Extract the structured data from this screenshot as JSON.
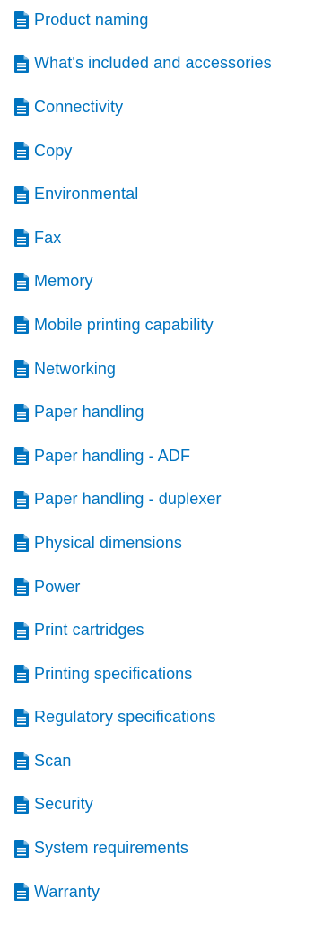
{
  "colors": {
    "link": "#0073bf",
    "background": "#ffffff"
  },
  "toc": {
    "icon": "document-icon",
    "items": [
      {
        "label": "Product naming"
      },
      {
        "label": "What's included and accessories"
      },
      {
        "label": "Connectivity"
      },
      {
        "label": "Copy"
      },
      {
        "label": "Environmental"
      },
      {
        "label": "Fax"
      },
      {
        "label": "Memory"
      },
      {
        "label": "Mobile printing capability"
      },
      {
        "label": "Networking"
      },
      {
        "label": "Paper handling"
      },
      {
        "label": "Paper handling - ADF"
      },
      {
        "label": "Paper handling - duplexer"
      },
      {
        "label": "Physical dimensions"
      },
      {
        "label": "Power"
      },
      {
        "label": "Print cartridges"
      },
      {
        "label": "Printing specifications"
      },
      {
        "label": "Regulatory specifications"
      },
      {
        "label": "Scan"
      },
      {
        "label": "Security"
      },
      {
        "label": "System requirements"
      },
      {
        "label": "Warranty"
      }
    ]
  }
}
